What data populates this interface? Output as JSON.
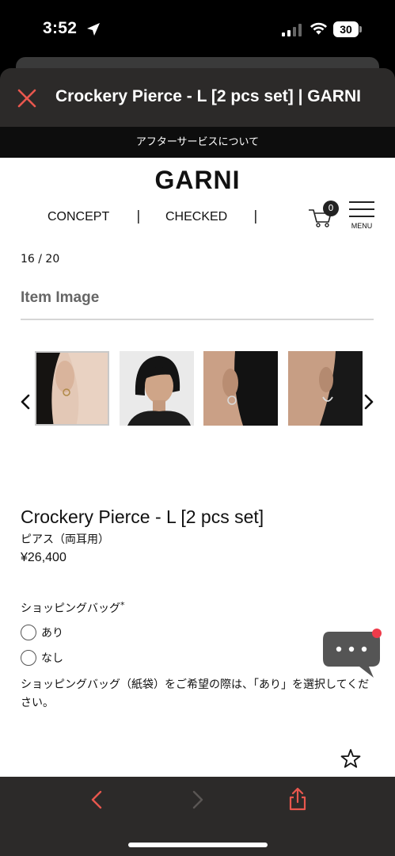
{
  "status_bar": {
    "time": "3:52",
    "battery": "30"
  },
  "sheet": {
    "title": "Crockery Pierce - L [2 pcs set] | GARNI",
    "close_icon": "close-icon"
  },
  "banner": {
    "text": "アフターサービスについて"
  },
  "header": {
    "logo": "GARNI",
    "nav": [
      "CONCEPT",
      "CHECKED"
    ],
    "separator": "|",
    "cart_count": "0",
    "menu_label": "MENU"
  },
  "gallery": {
    "counter": "16 / 20",
    "title": "Item Image",
    "thumbnails": [
      {
        "icon": "earring-closeup-image"
      },
      {
        "icon": "model-portrait-image"
      },
      {
        "icon": "ear-hoop-image"
      },
      {
        "icon": "ear-profile-image"
      }
    ]
  },
  "product": {
    "name": "Crockery Pierce - L [2 pcs set]",
    "subtitle": "ピアス（両耳用）",
    "price": "¥26,400"
  },
  "shopping_bag": {
    "label": "ショッピングバッグ",
    "required_mark": "*",
    "options": [
      "あり",
      "なし"
    ],
    "note": "ショッピングバッグ（紙袋）をご希望の際は、「あり」を選択してください。"
  },
  "colors": {
    "accent_red": "#e8574e",
    "toolbar_bg": "#2c2a29",
    "chat_bubble": "#555555",
    "notify_dot": "#ee3b4a"
  }
}
